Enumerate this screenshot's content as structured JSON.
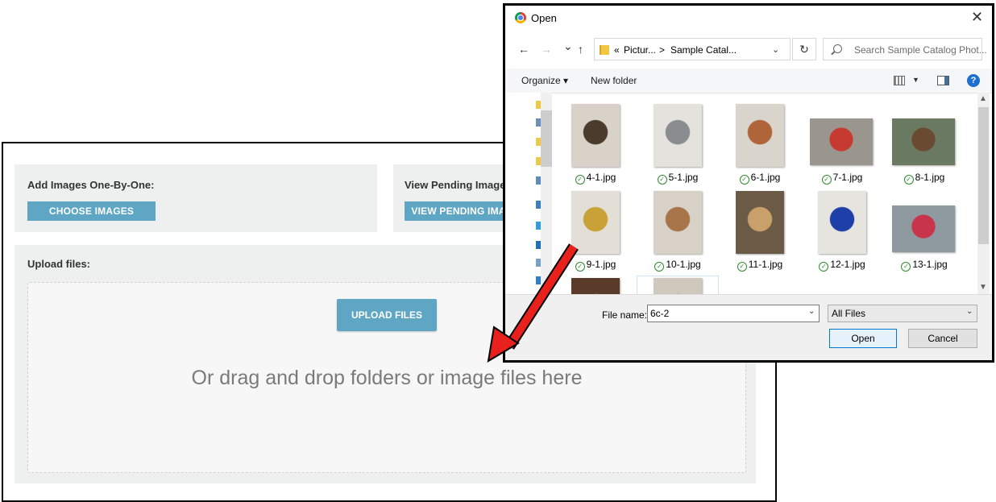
{
  "webpage": {
    "add_images": {
      "label": "Add Images One-By-One:",
      "button": "CHOOSE IMAGES"
    },
    "pending": {
      "label": "View Pending Images:",
      "button": "VIEW PENDING IMAGES"
    },
    "upload": {
      "label": "Upload files:",
      "button": "UPLOAD FILES",
      "drop_text": "Or drag and drop folders or image files here"
    }
  },
  "dialog": {
    "title": "Open",
    "close_glyph": "✕",
    "nav": {
      "back": "←",
      "forward": "→",
      "recent": "⌄",
      "up": "↑",
      "refresh": "↻"
    },
    "breadcrumb": {
      "sep_start": "«",
      "parent": "Pictur...",
      "sep": ">",
      "current": "Sample Catal..."
    },
    "search_placeholder": "Search Sample Catalog Phot...",
    "commands": {
      "organize": "Organize ▾",
      "new_folder": "New folder",
      "help": "?"
    },
    "files": [
      {
        "name": "4-1.jpg",
        "colors": [
          "#d8d2c8",
          "#4a3b2c"
        ]
      },
      {
        "name": "5-1.jpg",
        "colors": [
          "#e4e2dc",
          "#8a8d90"
        ]
      },
      {
        "name": "6-1.jpg",
        "colors": [
          "#d9d4cc",
          "#b0643a"
        ]
      },
      {
        "name": "7-1.jpg",
        "colors": [
          "#9a958d",
          "#c63a32"
        ]
      },
      {
        "name": "8-1.jpg",
        "colors": [
          "#6a7a62",
          "#6a4a30"
        ]
      },
      {
        "name": "9-1.jpg",
        "colors": [
          "#e3dfd6",
          "#c9a237"
        ]
      },
      {
        "name": "10-1.jpg",
        "colors": [
          "#d7d1c8",
          "#a8754a"
        ]
      },
      {
        "name": "11-1.jpg",
        "colors": [
          "#6b5a45",
          "#c9a06a"
        ]
      },
      {
        "name": "12-1.jpg",
        "colors": [
          "#e6e4df",
          "#1f3fa8"
        ]
      },
      {
        "name": "13-1.jpg",
        "colors": [
          "#8e9aa0",
          "#c8344a"
        ]
      },
      {
        "name": "",
        "colors": [
          "#5a3a28",
          "#c7a980"
        ]
      },
      {
        "name": "",
        "colors": [
          "#cfc8bd",
          "#8a6a45"
        ]
      }
    ],
    "file_name_label": "File name:",
    "file_name_value": "6c-2",
    "file_type": "All Files",
    "open_button": "Open",
    "cancel_button": "Cancel"
  },
  "colors": {
    "accent_button": "#5fa6c4",
    "panel_bg": "#eef0f0",
    "arrow": "#e8211d",
    "dialog_focus": "#0078d7"
  }
}
